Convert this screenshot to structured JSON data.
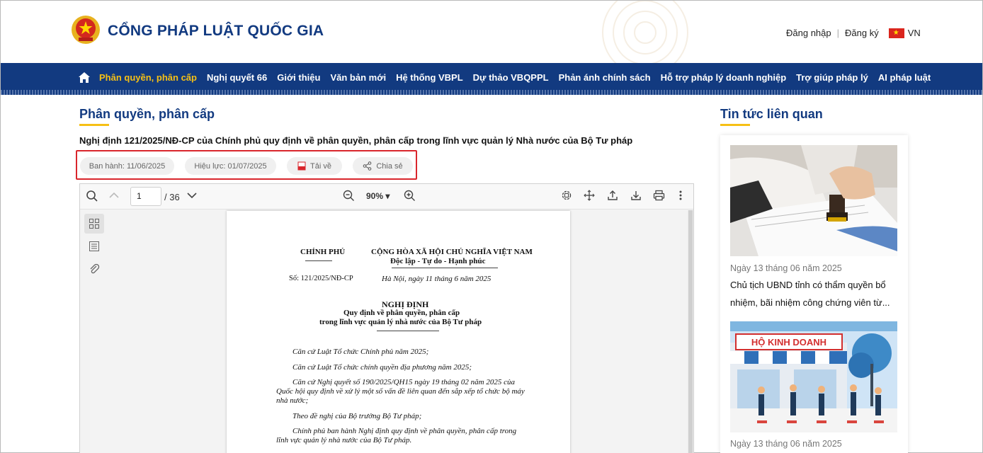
{
  "header": {
    "site_title": "CỔNG PHÁP LUẬT QUỐC GIA",
    "login": "Đăng nhập",
    "register": "Đăng ký",
    "lang": "VN"
  },
  "nav": {
    "items": [
      {
        "label": "Phân quyền, phân cấp",
        "active": true
      },
      {
        "label": "Nghị quyết 66"
      },
      {
        "label": "Giới thiệu"
      },
      {
        "label": "Văn bản mới"
      },
      {
        "label": "Hệ thống VBPL"
      },
      {
        "label": "Dự thảo VBQPPL"
      },
      {
        "label": "Phản ánh chính sách"
      },
      {
        "label": "Hỗ trợ pháp lý doanh nghiệp"
      },
      {
        "label": "Trợ giúp pháp lý"
      },
      {
        "label": "AI pháp luật"
      }
    ]
  },
  "main": {
    "section_title": "Phân quyền, phân cấp",
    "doc_title": "Nghị định 121/2025/NĐ-CP của Chính phủ quy định về phân quyền, phân cấp trong lĩnh vực quản lý Nhà nước của Bộ Tư pháp",
    "issued": "Ban hành: 11/06/2025",
    "effective": "Hiệu lực: 01/07/2025",
    "download": "Tải về",
    "share": "Chia sẻ"
  },
  "viewer": {
    "page": "1",
    "total": "/ 36",
    "zoom": "90%"
  },
  "pdf": {
    "left_org": "CHÍNH PHỦ",
    "right_org": "CỘNG HÒA XÃ HỘI CHỦ NGHĨA VIỆT NAM",
    "motto": "Độc lập - Tự do - Hạnh phúc",
    "number": "Số: 121/2025/NĐ-CP",
    "place_date": "Hà Nội, ngày 11 tháng 6 năm 2025",
    "doc_type": "NGHỊ ĐỊNH",
    "subject_1": "Quy định về phân quyền, phân cấp",
    "subject_2": "trong lĩnh vực quản lý nhà nước của Bộ Tư pháp",
    "p1": "Căn cứ Luật Tổ chức Chính phủ năm 2025;",
    "p2": "Căn cứ Luật Tổ chức chính quyền địa phương năm 2025;",
    "p3a": "Căn cứ Nghị quyết số 190/2025/QH15 ngày 19 tháng 02 năm 2025 của",
    "p3b": "Quốc hội quy định về xử lý một số vấn đề liên quan đến sắp xếp tổ chức bộ máy",
    "p3c": "nhà nước;",
    "p4": "Theo đề nghị của Bộ trưởng Bộ Tư pháp;",
    "p5a": "Chính phủ ban hành Nghị định quy định về phân quyền, phân cấp trong",
    "p5b": "lĩnh vực quản lý nhà nước của Bộ Tư pháp."
  },
  "sidebar": {
    "title": "Tin tức liên quan",
    "news": [
      {
        "date": "Ngày 13 tháng 06 năm 2025",
        "title": "Chủ tịch UBND tỉnh có thẩm quyền bổ nhiệm, bãi nhiệm công chứng viên từ..."
      },
      {
        "date": "Ngày 13 tháng 06 năm 2025",
        "sign": "HỘ KINH DOANH"
      }
    ]
  },
  "colors": {
    "brand_blue": "#123a80",
    "accent_yellow": "#f6c015",
    "highlight_red": "#d9262c"
  }
}
